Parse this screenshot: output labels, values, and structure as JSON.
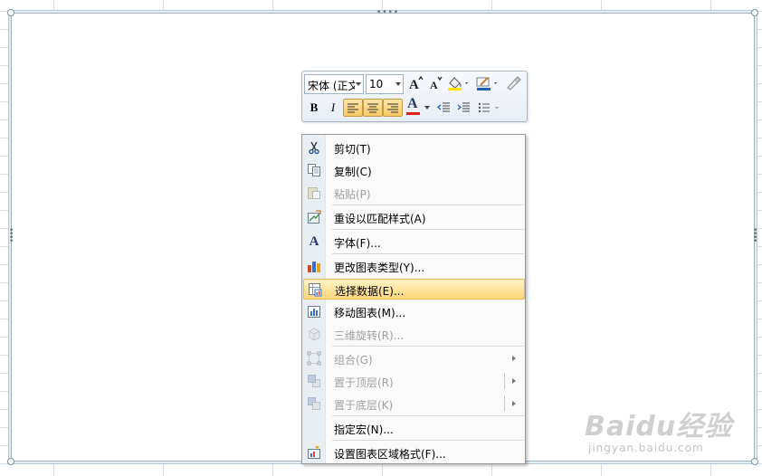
{
  "mini_toolbar": {
    "font_name": "宋体 (正文",
    "font_size": "10",
    "grow_font_icon": "font-grow-icon",
    "shrink_font_icon": "font-shrink-icon",
    "fill_color_icon": "fill-color-icon",
    "line_color_icon": "line-color-icon",
    "format_painter_icon": "format-painter-icon",
    "bold_label": "B",
    "italic_label": "I",
    "font_color_label": "A",
    "font_color": "#e0201b",
    "fill_color": "#ffe200"
  },
  "context_menu": {
    "items": [
      {
        "label": "剪切(T)",
        "icon": "cut-icon",
        "enabled": true
      },
      {
        "label": "复制(C)",
        "icon": "copy-icon",
        "enabled": true
      },
      {
        "label": "粘贴(P)",
        "icon": "paste-icon",
        "enabled": false
      },
      {
        "label": "重设以匹配样式(A)",
        "icon": "reset-style-icon",
        "enabled": true
      },
      {
        "label": "字体(F)...",
        "icon": "font-icon",
        "enabled": true
      },
      {
        "label": "更改图表类型(Y)...",
        "icon": "chart-type-icon",
        "enabled": true
      },
      {
        "label": "选择数据(E)...",
        "icon": "select-data-icon",
        "enabled": true,
        "highlighted": true
      },
      {
        "label": "移动图表(M)...",
        "icon": "move-chart-icon",
        "enabled": true
      },
      {
        "label": "三维旋转(R)...",
        "icon": "3d-rotation-icon",
        "enabled": false
      },
      {
        "label": "组合(G)",
        "icon": "group-icon",
        "enabled": false,
        "submenu": true
      },
      {
        "label": "置于顶层(R)",
        "icon": "bring-to-front-icon",
        "enabled": false,
        "submenu": true
      },
      {
        "label": "置于底层(K)",
        "icon": "send-to-back-icon",
        "enabled": false,
        "submenu": true
      },
      {
        "label": "指定宏(N)...",
        "icon": "assign-macro-icon",
        "enabled": true
      },
      {
        "label": "设置图表区域格式(F)...",
        "icon": "format-chart-area-icon",
        "enabled": true
      }
    ]
  },
  "watermark": {
    "logo": "Baidu经验",
    "url": "jingyan.baidu.com"
  }
}
